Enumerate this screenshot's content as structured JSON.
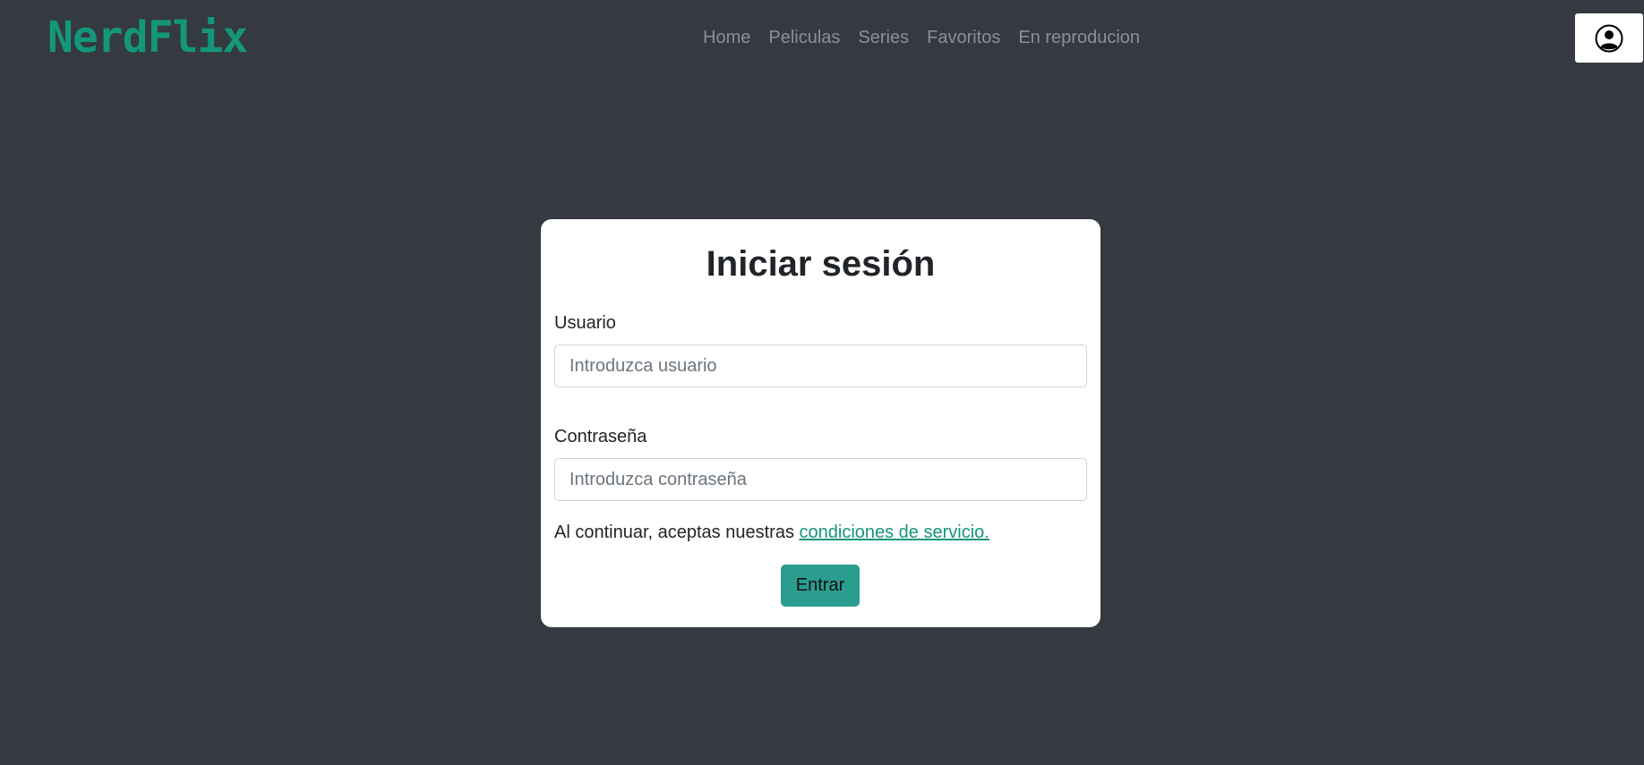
{
  "navbar": {
    "brand": "NerdFlix",
    "links": [
      "Home",
      "Peliculas",
      "Series",
      "Favoritos",
      "En reproducion"
    ],
    "user_icon": "user-circle-icon"
  },
  "login": {
    "title": "Iniciar sesión",
    "username_label": "Usuario",
    "username_placeholder": "Introduzca usuario",
    "username_value": "",
    "password_label": "Contraseña",
    "password_placeholder": "Introduzca contraseña",
    "password_value": "",
    "terms_text": "Al continuar, aceptas nuestras ",
    "terms_link": "condiciones de servicio.",
    "submit_label": "Entrar"
  },
  "colors": {
    "background": "#343a40",
    "brand": "#14967a",
    "button": "#2a9d8f"
  }
}
